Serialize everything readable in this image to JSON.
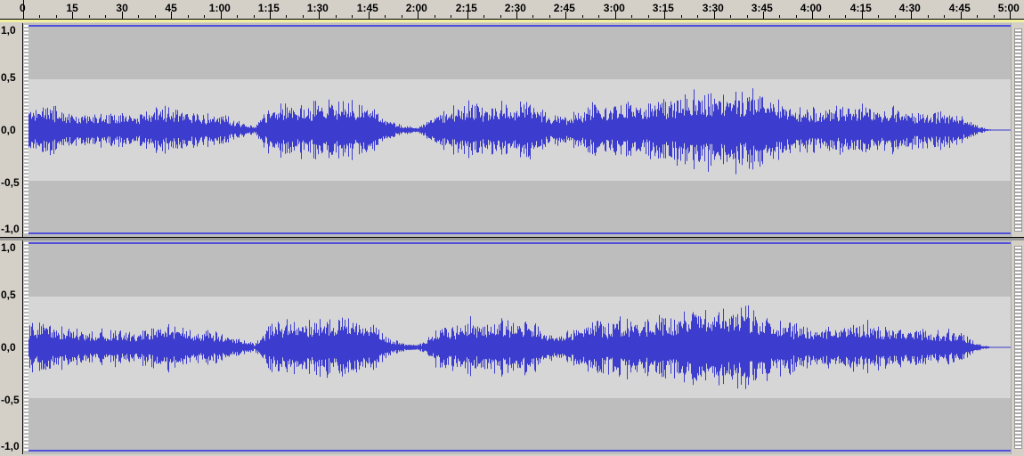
{
  "ruler": {
    "labels": [
      "0",
      "15",
      "30",
      "45",
      "1:00",
      "1:15",
      "1:30",
      "1:45",
      "2:00",
      "2:15",
      "2:30",
      "2:45",
      "3:00",
      "3:15",
      "3:30",
      "3:45",
      "4:00",
      "4:15",
      "4:30",
      "4:45",
      "5:00"
    ]
  },
  "tracks": [
    {
      "scale": [
        "1,0",
        "0,5",
        "0,0",
        "-0,5",
        "-1,0"
      ],
      "seed": 7
    },
    {
      "scale": [
        "1,0",
        "0,5",
        "0,0",
        "-0,5",
        "-1,0"
      ],
      "seed": 19
    }
  ],
  "colors": {
    "waveform": "#3c3ccf",
    "band_outer": "#bdbdbd",
    "band_inner": "#d6d6d6",
    "clip_line": "#5050d8"
  },
  "duration_seconds": 300,
  "envelope_step_seconds": 5,
  "envelope": [
    0.25,
    0.3,
    0.25,
    0.2,
    0.2,
    0.2,
    0.2,
    0.18,
    0.25,
    0.25,
    0.2,
    0.18,
    0.17,
    0.1,
    0.04,
    0.3,
    0.3,
    0.3,
    0.3,
    0.35,
    0.3,
    0.3,
    0.12,
    0.05,
    0.03,
    0.2,
    0.25,
    0.35,
    0.25,
    0.3,
    0.3,
    0.3,
    0.15,
    0.18,
    0.25,
    0.3,
    0.3,
    0.35,
    0.3,
    0.35,
    0.4,
    0.45,
    0.42,
    0.45,
    0.45,
    0.4,
    0.3,
    0.25,
    0.25,
    0.25,
    0.25,
    0.3,
    0.25,
    0.25,
    0.2,
    0.2,
    0.2,
    0.15,
    0.04,
    0.0
  ]
}
